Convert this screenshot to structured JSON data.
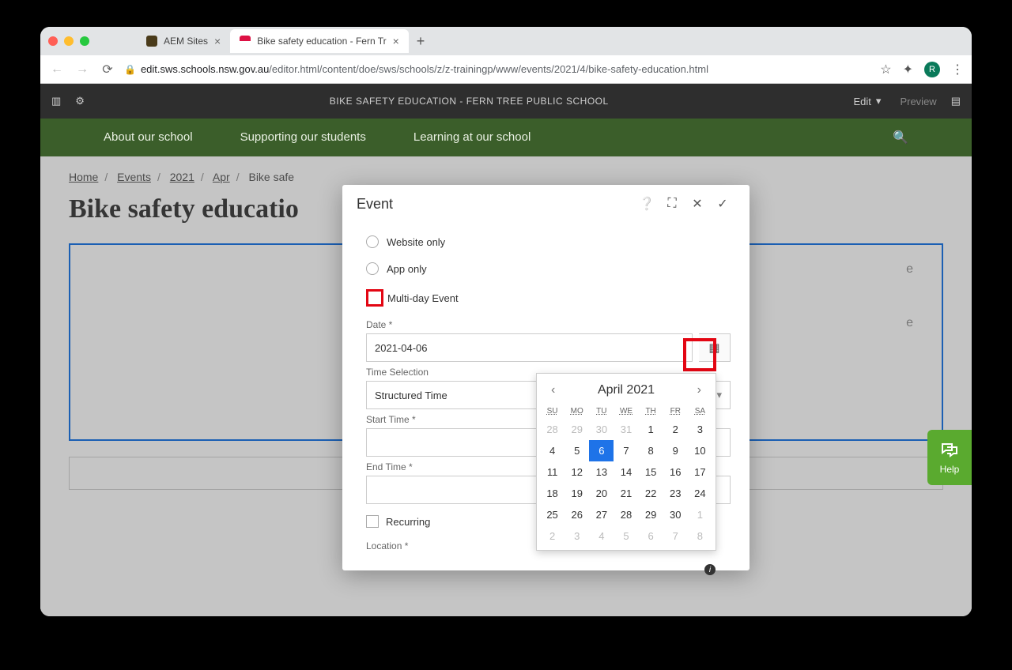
{
  "browser": {
    "tabs": [
      {
        "label": "AEM Sites",
        "icon_color": "#4a3b1a"
      },
      {
        "label": "Bike safety education - Fern Tr",
        "icon_color": "#d14"
      }
    ],
    "url_host": "edit.sws.schools.nsw.gov.au",
    "url_path": "/editor.html/content/doe/sws/schools/z/z-trainingp/www/events/2021/4/bike-safety-education.html",
    "avatar_letter": "R"
  },
  "aem": {
    "title": "BIKE SAFETY EDUCATION - FERN TREE PUBLIC SCHOOL",
    "mode": "Edit",
    "preview": "Preview"
  },
  "nav": {
    "items": [
      "About our school",
      "Supporting our students",
      "Learning at our school"
    ]
  },
  "breadcrumb": [
    "Home",
    "Events",
    "2021",
    "Apr",
    "Bike safe"
  ],
  "page_title": "Bike safety educatio",
  "region_hints": [
    "e",
    "e"
  ],
  "modal": {
    "title": "Event",
    "radio_website": "Website only",
    "radio_app": "App only",
    "check_multiday": "Multi-day Event",
    "date_label": "Date *",
    "date_value": "2021-04-06",
    "time_selection_label": "Time Selection",
    "time_selection_value": "Structured Time",
    "start_time_label": "Start Time *",
    "start_time_value": "",
    "end_time_label": "End Time *",
    "end_time_value": "",
    "check_recurring": "Recurring",
    "location_label": "Location *"
  },
  "calendar": {
    "month_label": "April 2021",
    "day_headers": [
      "SU",
      "MO",
      "TU",
      "WE",
      "TH",
      "FR",
      "SA"
    ],
    "weeks": [
      [
        {
          "d": "28",
          "out": true
        },
        {
          "d": "29",
          "out": true
        },
        {
          "d": "30",
          "out": true
        },
        {
          "d": "31",
          "out": true
        },
        {
          "d": "1"
        },
        {
          "d": "2"
        },
        {
          "d": "3"
        }
      ],
      [
        {
          "d": "4"
        },
        {
          "d": "5"
        },
        {
          "d": "6",
          "sel": true
        },
        {
          "d": "7"
        },
        {
          "d": "8"
        },
        {
          "d": "9"
        },
        {
          "d": "10"
        }
      ],
      [
        {
          "d": "11"
        },
        {
          "d": "12"
        },
        {
          "d": "13"
        },
        {
          "d": "14"
        },
        {
          "d": "15"
        },
        {
          "d": "16"
        },
        {
          "d": "17"
        }
      ],
      [
        {
          "d": "18"
        },
        {
          "d": "19"
        },
        {
          "d": "20"
        },
        {
          "d": "21"
        },
        {
          "d": "22"
        },
        {
          "d": "23"
        },
        {
          "d": "24"
        }
      ],
      [
        {
          "d": "25"
        },
        {
          "d": "26"
        },
        {
          "d": "27"
        },
        {
          "d": "28"
        },
        {
          "d": "29"
        },
        {
          "d": "30"
        },
        {
          "d": "1",
          "out": true
        }
      ],
      [
        {
          "d": "2",
          "out": true
        },
        {
          "d": "3",
          "out": true
        },
        {
          "d": "4",
          "out": true
        },
        {
          "d": "5",
          "out": true
        },
        {
          "d": "6",
          "out": true
        },
        {
          "d": "7",
          "out": true
        },
        {
          "d": "8",
          "out": true
        }
      ]
    ]
  },
  "help_label": "Help"
}
